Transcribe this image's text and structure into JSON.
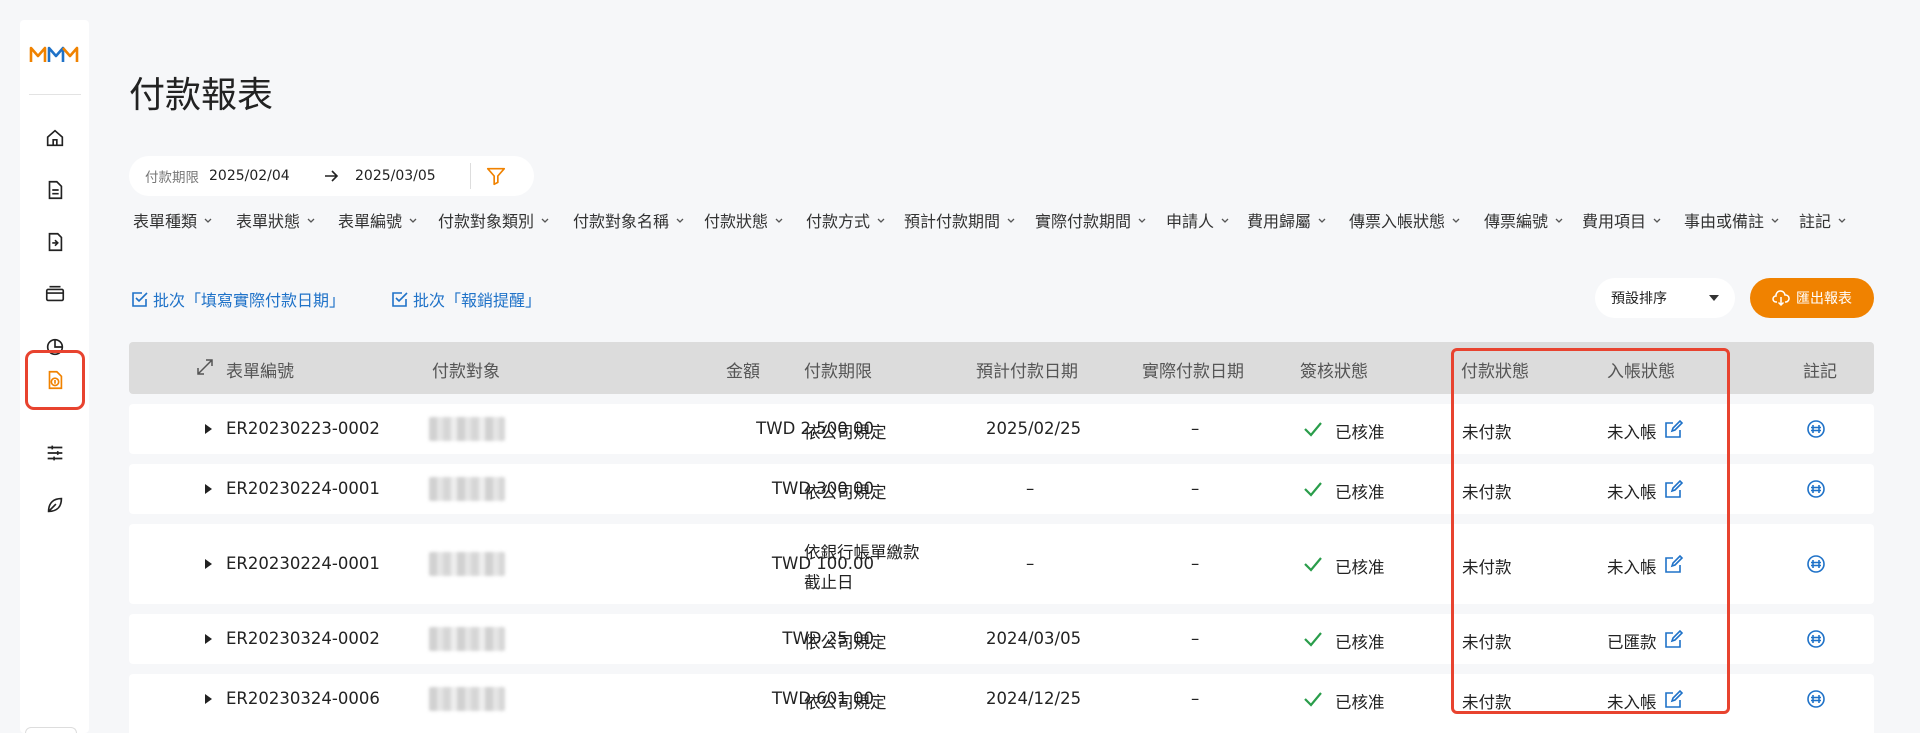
{
  "page": {
    "title": "付款報表"
  },
  "date_filter": {
    "label": "付款期限",
    "start": "2025/02/04",
    "end": "2025/03/05"
  },
  "filters": [
    "表單種類",
    "表單狀態",
    "表單編號",
    "付款對象類別",
    "付款對象名稱",
    "付款狀態",
    "付款方式",
    "預計付款期間",
    "實際付款期間",
    "申請人",
    "費用歸屬",
    "傳票入帳狀態",
    "傳票編號",
    "費用項目",
    "事由或備註",
    "註記"
  ],
  "actions": {
    "batch_pay_date": "批次「填寫實際付款日期」",
    "batch_reminder": "批次「報銷提醒」",
    "sort_label": "預設排序",
    "export_label": "匯出報表"
  },
  "table": {
    "headers": {
      "form_no": "表單編號",
      "payee": "付款對象",
      "amount": "金額",
      "due": "付款期限",
      "planned_date": "預計付款日期",
      "actual_date": "實際付款日期",
      "approval": "簽核狀態",
      "pay_status": "付款狀態",
      "post_status": "入帳狀態",
      "note": "註記"
    },
    "rows": [
      {
        "form_no": "ER20230223-0002",
        "amount": "TWD 2,500.00",
        "due": "依公司規定",
        "due2": "",
        "planned_date": "2025/02/25",
        "actual_date": "–",
        "approval": "已核准",
        "pay_status": "未付款",
        "post_status": "未入帳"
      },
      {
        "form_no": "ER20230224-0001",
        "amount": "TWD 300.00",
        "due": "依公司規定",
        "due2": "",
        "planned_date": "–",
        "actual_date": "–",
        "approval": "已核准",
        "pay_status": "未付款",
        "post_status": "未入帳"
      },
      {
        "form_no": "ER20230224-0001",
        "amount": "TWD 100.00",
        "due": "依銀行帳單繳款",
        "due2": "截止日",
        "planned_date": "–",
        "actual_date": "–",
        "approval": "已核准",
        "pay_status": "未付款",
        "post_status": "未入帳"
      },
      {
        "form_no": "ER20230324-0002",
        "amount": "TWD 25.00",
        "due": "依公司規定",
        "due2": "",
        "planned_date": "2024/03/05",
        "actual_date": "–",
        "approval": "已核准",
        "pay_status": "未付款",
        "post_status": "已匯款"
      },
      {
        "form_no": "ER20230324-0006",
        "amount": "TWD 601.00",
        "due": "依公司規定",
        "due2": "",
        "planned_date": "2024/12/25",
        "actual_date": "–",
        "approval": "已核准",
        "pay_status": "未付款",
        "post_status": "未入帳"
      }
    ]
  },
  "colors": {
    "accent": "#f08200",
    "link": "#1f72c8",
    "highlight": "#e8432f",
    "approved": "#2a9d4b"
  }
}
